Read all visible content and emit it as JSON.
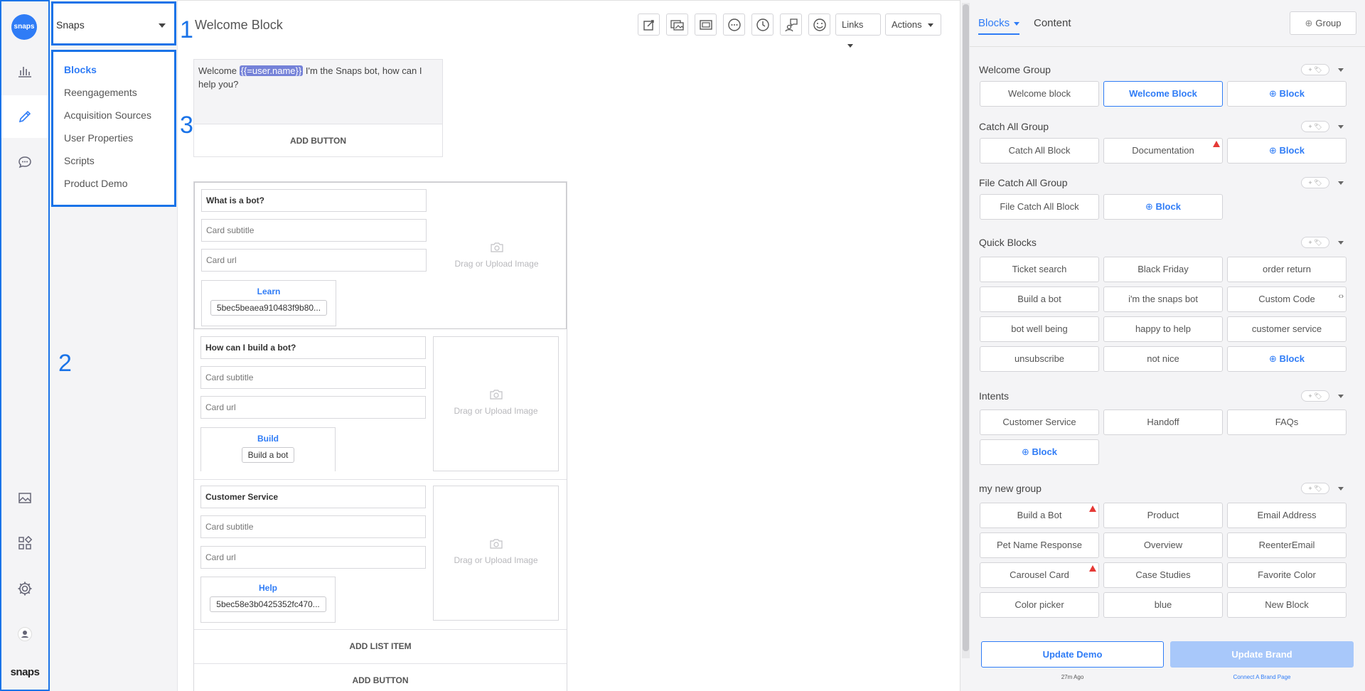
{
  "rail": {
    "logo": "snaps",
    "brand": "snaps"
  },
  "annotations": {
    "a1": "1",
    "a2": "2",
    "a3": "3"
  },
  "bot_select": {
    "value": "Snaps"
  },
  "nav": {
    "items": [
      "Blocks",
      "Reengagements",
      "Acquisition Sources",
      "User Properties",
      "Scripts",
      "Product Demo"
    ],
    "active": "Blocks"
  },
  "header": {
    "title": "Welcome Block",
    "links_label": "Links",
    "actions_label": "Actions"
  },
  "text_card": {
    "pre": "Welcome ",
    "tag": "{{=user.name}}",
    "post": " I'm the Snaps bot, how can I help you?",
    "add_button": "ADD BUTTON"
  },
  "cards": [
    {
      "title": "What is a bot?",
      "subtitle": "Card subtitle",
      "url": "Card url",
      "button_label": "Learn",
      "button_value": "5bec5beaea910483f9b80...",
      "image": "Drag or Upload Image"
    },
    {
      "title": "How can I build a bot?",
      "subtitle": "Card subtitle",
      "url": "Card url",
      "button_label": "Build",
      "button_value": "Build a bot",
      "image": "Drag or Upload Image"
    },
    {
      "title": "Customer Service",
      "subtitle": "Card subtitle",
      "url": "Card url",
      "button_label": "Help",
      "button_value": "5bec58e3b0425352fc470...",
      "image": "Drag or Upload Image"
    }
  ],
  "gallery": {
    "add_list_item": "ADD LIST ITEM",
    "add_button": "ADD BUTTON"
  },
  "panel": {
    "tab_blocks": "Blocks",
    "tab_content": "Content",
    "group_button": "Group",
    "groups": [
      {
        "name": "Welcome Group",
        "blocks": [
          "Welcome block",
          "Welcome Block",
          "Block"
        ]
      },
      {
        "name": "Catch All Group",
        "blocks": [
          "Catch All Block",
          "Documentation",
          "Block"
        ]
      },
      {
        "name": "File Catch All Group",
        "blocks": [
          "File Catch All Block",
          "Block"
        ]
      },
      {
        "name": "Quick Blocks",
        "blocks": [
          "Ticket search",
          "Black Friday",
          "order return",
          "Build a bot",
          "i'm the snaps bot",
          "Custom Code",
          "bot well being",
          "happy to help",
          "customer service",
          "unsubscribe",
          "not nice",
          "Block"
        ]
      },
      {
        "name": "Intents",
        "blocks": [
          "Customer Service",
          "Handoff",
          "FAQs",
          "Block"
        ]
      },
      {
        "name": "my new group",
        "blocks": [
          "Build a Bot",
          "Product",
          "Email Address",
          "Pet Name Response",
          "Overview",
          "ReenterEmail",
          "Carousel  Card",
          "Case Studies",
          "Favorite Color",
          "Color picker",
          "blue",
          "New Block"
        ]
      }
    ],
    "update_demo": "Update Demo",
    "update_brand": "Update Brand",
    "last_updated": "27m Ago",
    "connect_link": "Connect A Brand Page"
  },
  "colors": {
    "accent": "#2f7cf6",
    "annotation": "#1a73e8",
    "warning": "#e53935",
    "tag": "#7582d8"
  }
}
